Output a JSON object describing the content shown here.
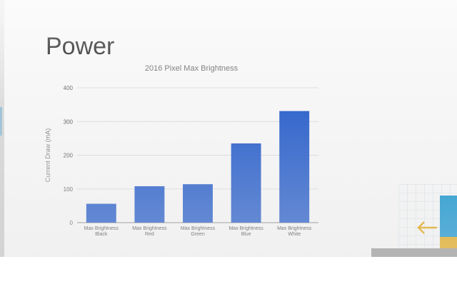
{
  "slide": {
    "title": "Power"
  },
  "chart_data": {
    "type": "bar",
    "title": "2016 Pixel Max Brightness",
    "xlabel": "",
    "ylabel": "Current Draw (mA)",
    "categories": [
      [
        "Max Brightness",
        "Black"
      ],
      [
        "Max Brightness",
        "Red"
      ],
      [
        "Max Brightness",
        "Green"
      ],
      [
        "Max Brightness",
        "Blue"
      ],
      [
        "Max Brightness",
        "White"
      ]
    ],
    "values": [
      56,
      108,
      114,
      235,
      331
    ],
    "ylim": [
      0,
      400
    ],
    "yticks": [
      "0",
      "100",
      "200",
      "300",
      "400"
    ],
    "grid": true,
    "legend": "none",
    "bar_color": "#3366cc"
  },
  "decoration": {
    "arrow_color": "#e2a91d",
    "panel_color": "#1b96cf"
  }
}
